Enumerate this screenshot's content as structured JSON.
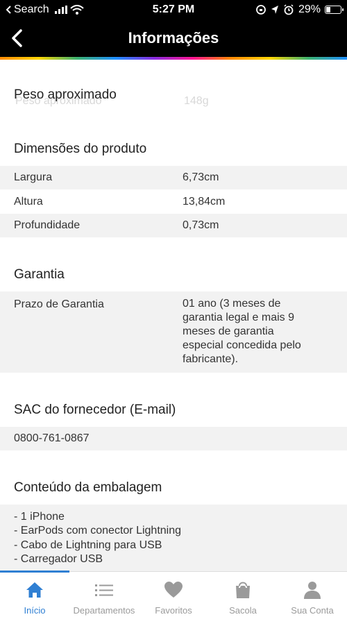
{
  "status_bar": {
    "back_app": "Search",
    "time": "5:27 PM",
    "battery": "29%",
    "battery_level": 0.29
  },
  "header": {
    "title": "Informações"
  },
  "sections": {
    "peso": {
      "title": "Peso aproximado",
      "ghost_label": "Peso aproximado",
      "ghost_value": "148g"
    },
    "dimensoes": {
      "title": "Dimensões do produto",
      "rows": [
        {
          "label": "Largura",
          "value": "6,73cm"
        },
        {
          "label": "Altura",
          "value": "13,84cm"
        },
        {
          "label": "Profundidade",
          "value": "0,73cm"
        }
      ]
    },
    "garantia": {
      "title": "Garantia",
      "label": "Prazo de Garantia",
      "value_lines": [
        "01 ano (3 meses de",
        "garantia legal e mais 9",
        "meses de garantia",
        "especial concedida pelo",
        "fabricante)."
      ]
    },
    "sac": {
      "title": "SAC do fornecedor (E-mail)",
      "value": "0800-761-0867"
    },
    "conteudo": {
      "title": "Conteúdo da embalagem",
      "items": [
        "- 1 iPhone",
        "- EarPods com conector Lightning",
        "- Cabo de Lightning para USB",
        "- Carregador USB"
      ]
    }
  },
  "tabbar": {
    "active_color": "#2f7fd3",
    "tabs": [
      {
        "label": "Início",
        "icon": "home-icon",
        "active": true
      },
      {
        "label": "Departamentos",
        "icon": "list-icon",
        "active": false
      },
      {
        "label": "Favoritos",
        "icon": "heart-icon",
        "active": false
      },
      {
        "label": "Sacola",
        "icon": "bag-icon",
        "active": false
      },
      {
        "label": "Sua Conta",
        "icon": "user-icon",
        "active": false
      }
    ]
  }
}
